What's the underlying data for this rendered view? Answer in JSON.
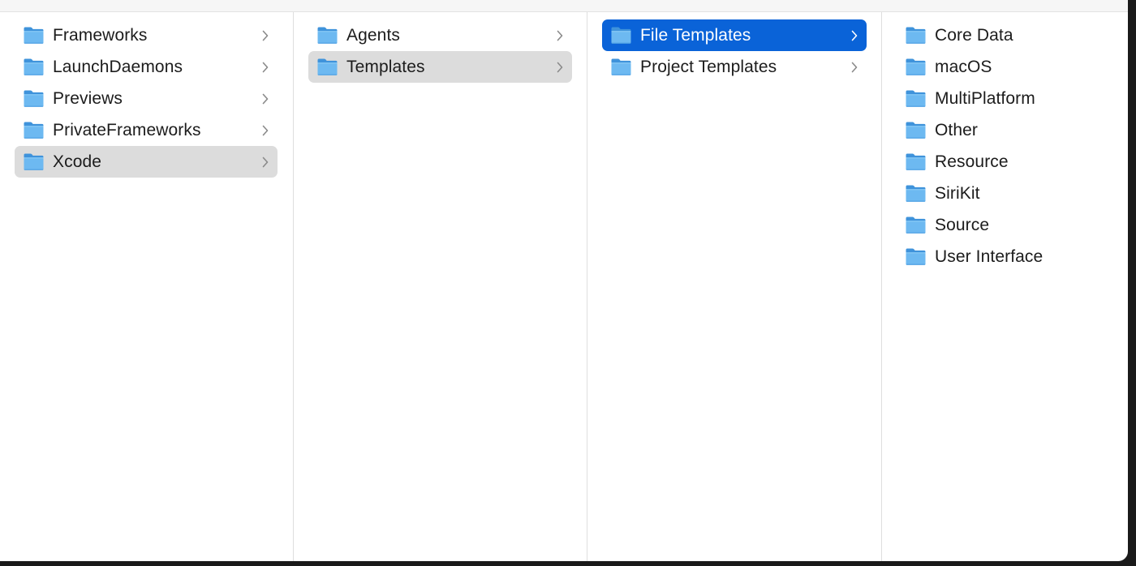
{
  "columns": [
    {
      "items": [
        {
          "label": "Frameworks",
          "has_children": true,
          "state": "normal"
        },
        {
          "label": "LaunchDaemons",
          "has_children": true,
          "state": "normal"
        },
        {
          "label": "Previews",
          "has_children": true,
          "state": "normal"
        },
        {
          "label": "PrivateFrameworks",
          "has_children": true,
          "state": "normal"
        },
        {
          "label": "Xcode",
          "has_children": true,
          "state": "selected-inactive"
        }
      ]
    },
    {
      "items": [
        {
          "label": "Agents",
          "has_children": true,
          "state": "normal"
        },
        {
          "label": "Templates",
          "has_children": true,
          "state": "selected-inactive"
        }
      ]
    },
    {
      "items": [
        {
          "label": "File Templates",
          "has_children": true,
          "state": "selected-active"
        },
        {
          "label": "Project Templates",
          "has_children": true,
          "state": "normal"
        }
      ]
    },
    {
      "items": [
        {
          "label": "Core Data",
          "has_children": false,
          "state": "normal"
        },
        {
          "label": "macOS",
          "has_children": false,
          "state": "normal"
        },
        {
          "label": "MultiPlatform",
          "has_children": false,
          "state": "normal"
        },
        {
          "label": "Other",
          "has_children": false,
          "state": "normal"
        },
        {
          "label": "Resource",
          "has_children": false,
          "state": "normal"
        },
        {
          "label": "SiriKit",
          "has_children": false,
          "state": "normal"
        },
        {
          "label": "Source",
          "has_children": false,
          "state": "normal"
        },
        {
          "label": "User Interface",
          "has_children": false,
          "state": "normal"
        }
      ]
    }
  ],
  "icons": {
    "folder": "folder-icon",
    "chevron": "chevron-right-icon"
  },
  "colors": {
    "selection_active": "#0a63d8",
    "selection_inactive": "#dcdcdc",
    "folder_fill": "#6cb8f0",
    "folder_tab": "#4a9ae0"
  }
}
